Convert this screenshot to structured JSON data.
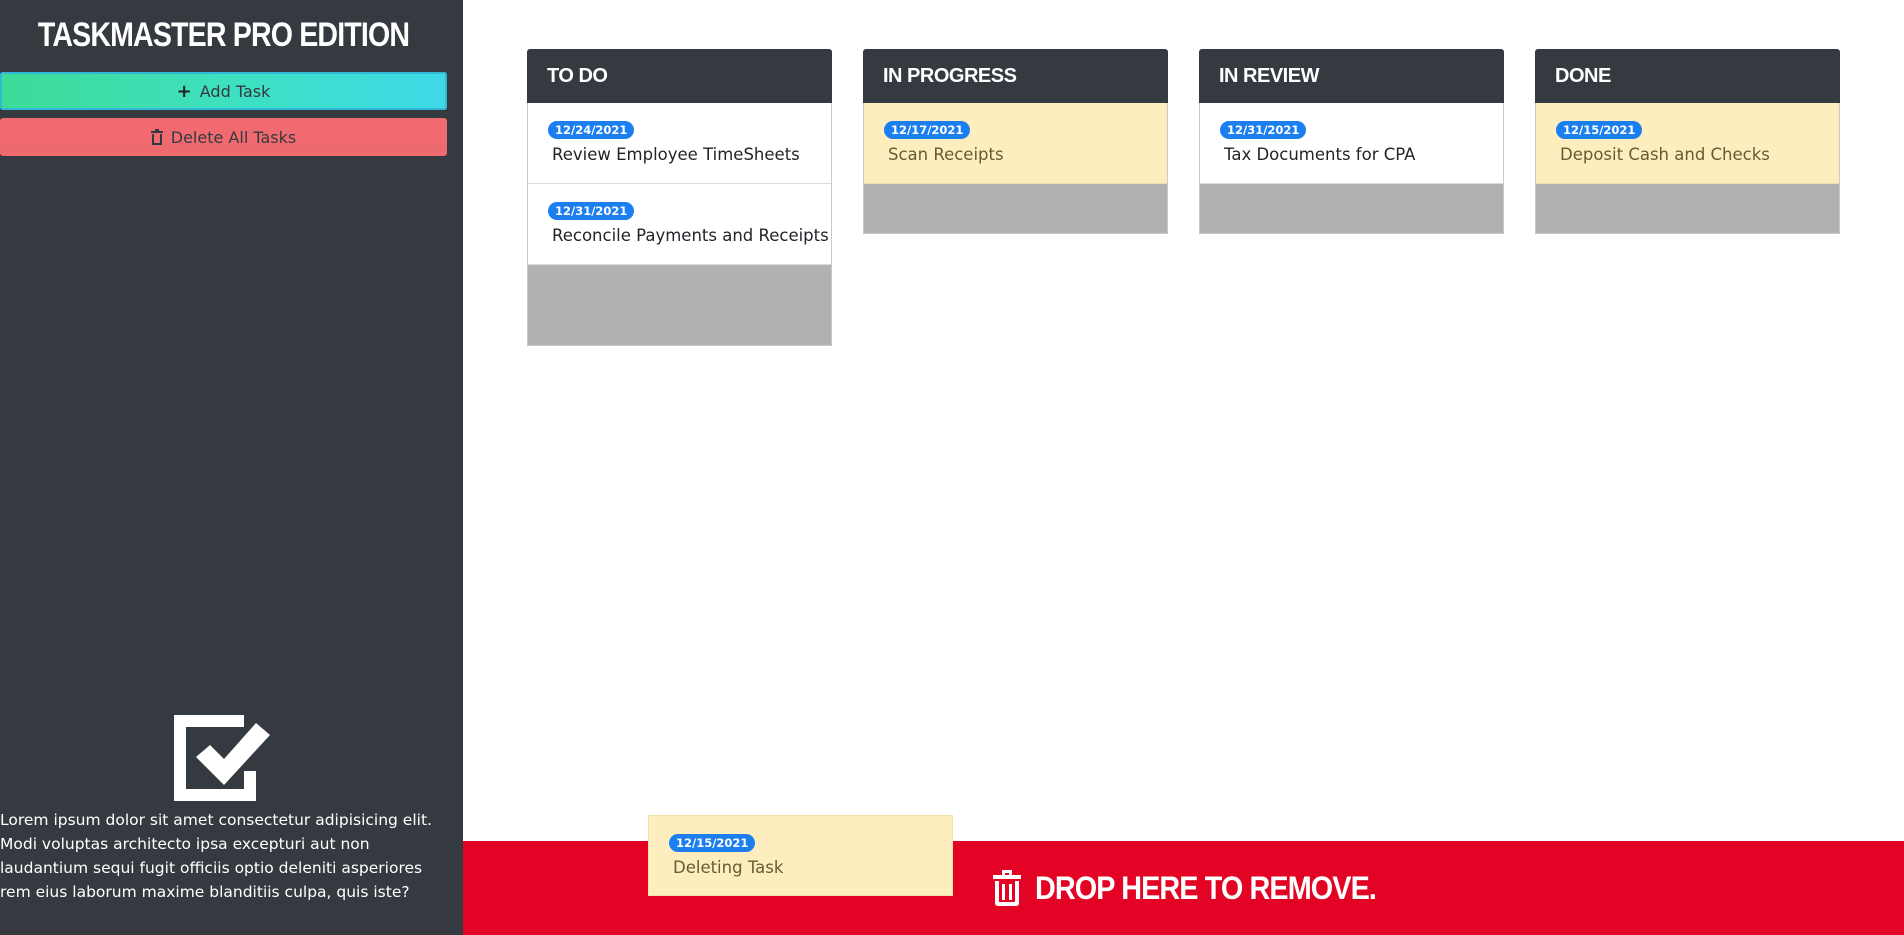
{
  "app": {
    "title": "TASKMASTER PRO EDITION"
  },
  "sidebar": {
    "add_label": "Add Task",
    "delete_label": "Delete All Tasks",
    "description": "Lorem ipsum dolor sit amet consectetur adipisicing elit. Modi voluptas architecto ipsa excepturi aut non laudantium sequi fugit officiis optio deleniti asperiores rem eius laborum maxime blanditiis culpa, quis iste?"
  },
  "columns": [
    {
      "title": "TO DO",
      "tasks": [
        {
          "date": "12/24/2021",
          "text": "Review Employee TimeSheets",
          "status_color": "white"
        },
        {
          "date": "12/31/2021",
          "text": "Reconcile Payments and Receipts",
          "status_color": "white"
        }
      ]
    },
    {
      "title": "IN PROGRESS",
      "tasks": [
        {
          "date": "12/17/2021",
          "text": "Scan Receipts",
          "status_color": "yellow"
        }
      ]
    },
    {
      "title": "IN REVIEW",
      "tasks": [
        {
          "date": "12/31/2021",
          "text": "Tax Documents for CPA",
          "status_color": "white"
        }
      ]
    },
    {
      "title": "DONE",
      "tasks": [
        {
          "date": "12/15/2021",
          "text": "Deposit Cash and Checks",
          "status_color": "yellow"
        }
      ]
    }
  ],
  "drop_zone": {
    "label": "DROP HERE TO REMOVE."
  },
  "dragging": {
    "date": "12/15/2021",
    "text": "Deleting Task"
  },
  "colors": {
    "sidebar": "#343a40",
    "badge": "#1b7ff0",
    "drop_zone": "#e30425",
    "yellow_card": "#fdedbf",
    "add_button": "#3ee0c3",
    "delete_button": "#ef6a6e"
  },
  "icons": {
    "add": "plus-icon",
    "delete": "trash-icon",
    "logo": "checkbox-check-icon",
    "drop": "trash-icon"
  }
}
